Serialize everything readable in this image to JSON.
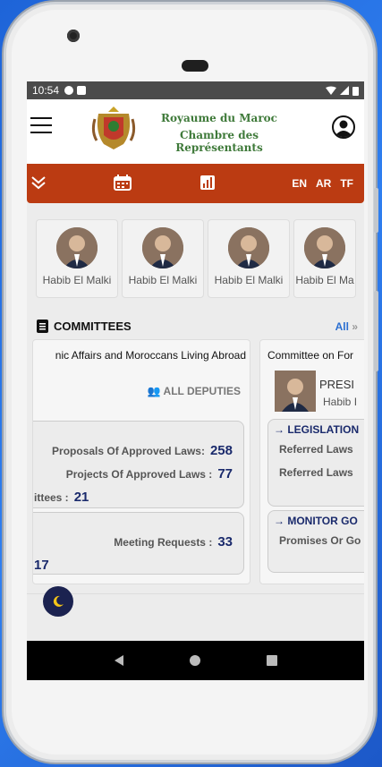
{
  "status": {
    "time": "10:54"
  },
  "header": {
    "title_line1": "Royaume du Maroc",
    "title_line2": "Chambre des Représentants"
  },
  "toolbar": {
    "languages": [
      "EN",
      "AR",
      "TF"
    ]
  },
  "deputies": [
    {
      "name": "Habib El Malki"
    },
    {
      "name": "Habib El Malki"
    },
    {
      "name": "Habib El Malki"
    },
    {
      "name": "Habib El Ma"
    }
  ],
  "committees": {
    "heading": "COMMITTEES",
    "all_link": "All",
    "card1": {
      "title": "nic Affairs and Moroccans Living Abroad",
      "all_deputies": "ALL DEPUTIES",
      "proposals_label": "Proposals Of Approved Laws:",
      "proposals_value": "258",
      "projects_label": "Projects Of Approved Laws :",
      "projects_value": "77",
      "committees_label": "ittees :",
      "committees_value": "21",
      "meeting_label": "Meeting Requests :",
      "meeting_value": "33",
      "cut_value": "17"
    },
    "card2": {
      "title": "Committee on For",
      "president_label": "PRESI",
      "president_name": "Habib I",
      "legislation_head": "LEGISLATION",
      "referred_laws_1": "Referred Laws",
      "referred_laws_2": "Referred Laws",
      "monitor_head": "MONITOR GO",
      "promises": "Promises Or Go"
    }
  },
  "colors": {
    "toolbar_bg": "#bb3b12",
    "title_green": "#3f7a3a",
    "number_navy": "#1a2a6c",
    "link_blue": "#2b6fd1"
  }
}
